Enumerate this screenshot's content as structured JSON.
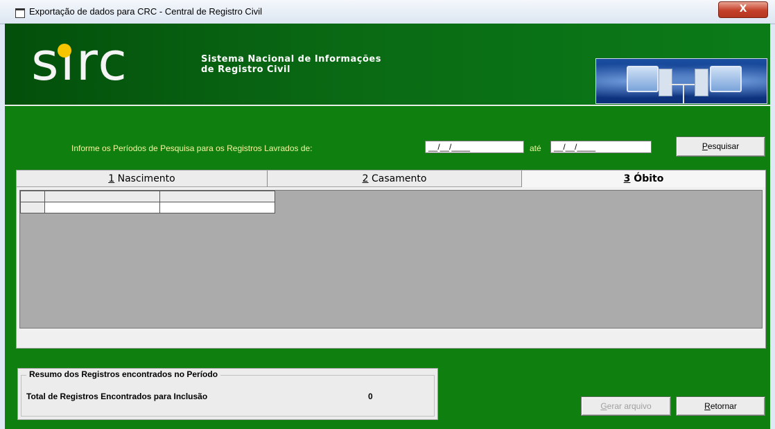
{
  "window": {
    "title": "Exportação de dados para CRC  - Central de Registro Civil",
    "close_label": "X"
  },
  "banner": {
    "logo_text": "sırc",
    "subtitle_line1": "Sistema Nacional de Informações",
    "subtitle_line2": "de Registro Civil"
  },
  "search": {
    "period_label": "Informe os Períodos de Pesquisa para os Registros Lavrados de:",
    "date_from_value": "__/__/____",
    "until_label": "até",
    "date_to_value": "__/__/____",
    "button_mnemonic": "P",
    "button_rest": "esquisar"
  },
  "tabs": [
    {
      "mnemonic": "1",
      "label": " Nascimento"
    },
    {
      "mnemonic": "2",
      "label": " Casamento"
    },
    {
      "mnemonic": "3",
      "label": " Óbito"
    }
  ],
  "summary": {
    "legend": "Resumo dos Registros encontrados no Período",
    "total_label": "Total de Registros Encontrados para Inclusão",
    "total_value": "0"
  },
  "actions": {
    "gerar_mnemonic": "G",
    "gerar_rest": "erar arquivo",
    "retornar_mnemonic": "R",
    "retornar_rest": "etornar"
  },
  "colors": {
    "client_green": "#0f7f0f",
    "label_yellow": "#f6f6a0",
    "logo_dot": "#f7c500"
  }
}
